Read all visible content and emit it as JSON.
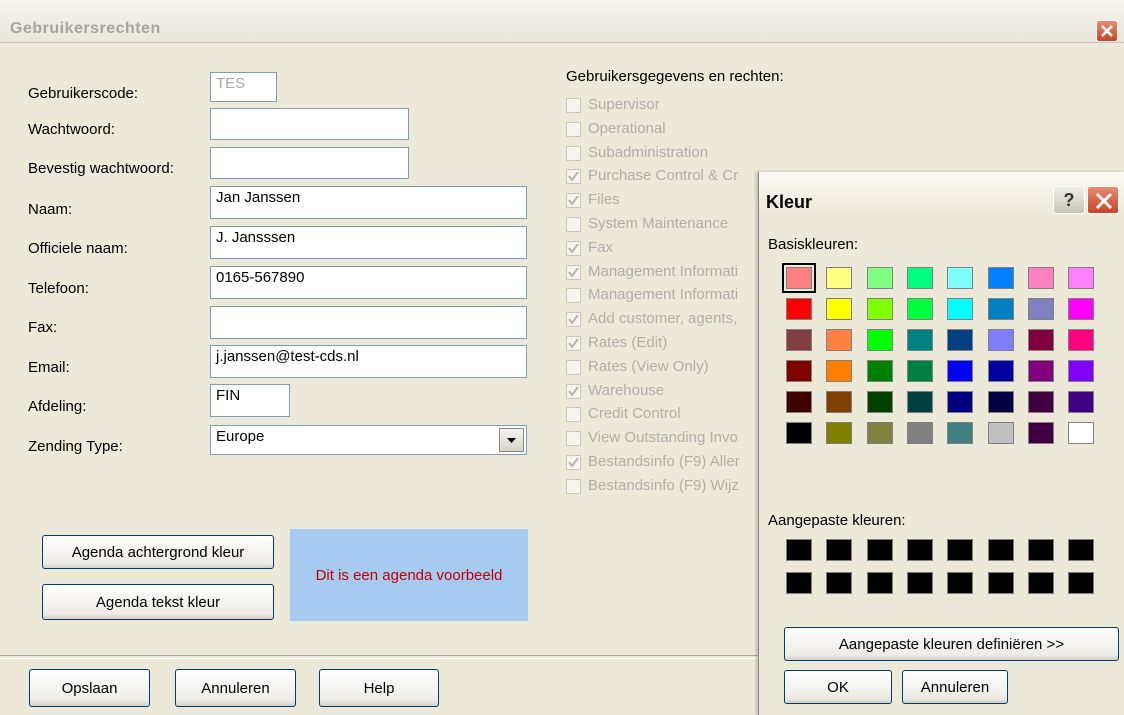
{
  "window": {
    "title": "Gebruikersrechten"
  },
  "form": {
    "code_label": "Gebruikerscode:",
    "code_value": "TES",
    "password_label": "Wachtwoord:",
    "password_value": "",
    "confirm_label": "Bevestig wachtwoord:",
    "confirm_value": "",
    "name_label": "Naam:",
    "name_value": "Jan Janssen",
    "official_label": "Officiele naam:",
    "official_value": "J. Jansssen",
    "phone_label": "Telefoon:",
    "phone_value": "0165-567890",
    "fax_label": "Fax:",
    "fax_value": "",
    "email_label": "Email:",
    "email_value": "j.janssen@test-cds.nl",
    "dept_label": "Afdeling:",
    "dept_value": "FIN",
    "shipping_label": "Zending Type:",
    "shipping_value": "Europe"
  },
  "rights": {
    "header": "Gebruikersgegevens en rechten:",
    "items": [
      {
        "label": "Supervisor",
        "checked": false
      },
      {
        "label": "Operational",
        "checked": false
      },
      {
        "label": "Subadministration",
        "checked": false
      },
      {
        "label": "Purchase Control & Cr",
        "checked": true
      },
      {
        "label": "Files",
        "checked": true
      },
      {
        "label": "System Maintenance",
        "checked": false
      },
      {
        "label": "Fax",
        "checked": true
      },
      {
        "label": "Management Informati",
        "checked": true
      },
      {
        "label": "Management Informati",
        "checked": false
      },
      {
        "label": "Add customer, agents,",
        "checked": true
      },
      {
        "label": "Rates (Edit)",
        "checked": true
      },
      {
        "label": "Rates (View Only)",
        "checked": false
      },
      {
        "label": "Warehouse",
        "checked": true
      },
      {
        "label": "Credit Control",
        "checked": false
      },
      {
        "label": "View Outstanding Invo",
        "checked": false
      },
      {
        "label": "Bestandsinfo (F9) Aller",
        "checked": true
      },
      {
        "label": "Bestandsinfo (F9) Wijz",
        "checked": false
      }
    ]
  },
  "agenda": {
    "bg_button": "Agenda achtergrond kleur",
    "text_button": "Agenda tekst kleur",
    "preview_text": "Dit is een agenda voorbeeld",
    "preview_bg": "#A6CAF0",
    "preview_fg": "#C00000"
  },
  "footer": {
    "save": "Opslaan",
    "cancel": "Annuleren",
    "help": "Help"
  },
  "color_dialog": {
    "title": "Kleur",
    "help_glyph": "?",
    "basic_label": "Basiskleuren:",
    "custom_label": "Aangepaste kleuren:",
    "define_button": "Aangepaste kleuren definiëren >>",
    "ok_button": "OK",
    "cancel_button": "Annuleren",
    "basic_colors": [
      [
        "#FF8080",
        "#FFFF80",
        "#80FF80",
        "#00FF80",
        "#80FFFF",
        "#0080FF",
        "#FF80C0",
        "#FF80FF"
      ],
      [
        "#FF0000",
        "#FFFF00",
        "#80FF00",
        "#00FF40",
        "#00FFFF",
        "#0080C0",
        "#8080C0",
        "#FF00FF"
      ],
      [
        "#804040",
        "#FF8040",
        "#00FF00",
        "#008080",
        "#004080",
        "#8080FF",
        "#800040",
        "#FF0080"
      ],
      [
        "#800000",
        "#FF8000",
        "#008000",
        "#008040",
        "#0000FF",
        "#0000A0",
        "#800080",
        "#8000FF"
      ],
      [
        "#400000",
        "#804000",
        "#004000",
        "#004040",
        "#000080",
        "#000040",
        "#400040",
        "#400080"
      ],
      [
        "#000000",
        "#808000",
        "#808040",
        "#808080",
        "#408080",
        "#C0C0C0",
        "#400040",
        "#FFFFFF"
      ]
    ],
    "custom_colors": [
      [
        "#000000",
        "#000000",
        "#000000",
        "#000000",
        "#000000",
        "#000000",
        "#000000",
        "#000000"
      ],
      [
        "#000000",
        "#000000",
        "#000000",
        "#000000",
        "#000000",
        "#000000",
        "#000000",
        "#000000"
      ]
    ]
  }
}
